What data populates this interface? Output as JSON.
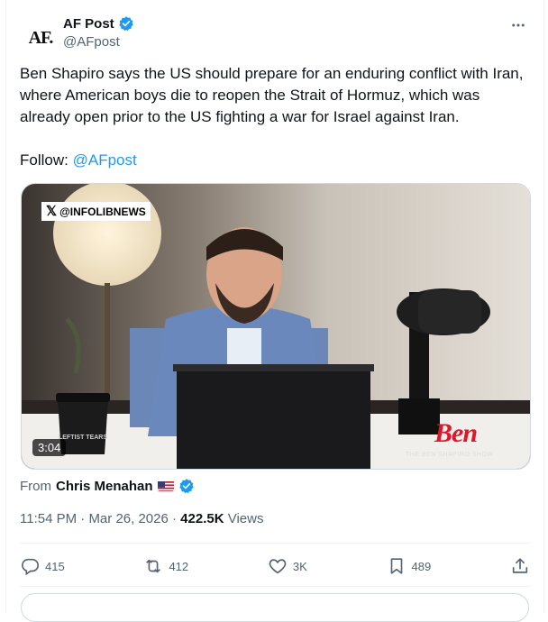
{
  "account": {
    "avatar_text": "AF.",
    "display_name": "AF Post",
    "handle": "@AFpost"
  },
  "tweet": {
    "text": "Ben Shapiro says the US should prepare for an enduring conflict with Iran, where American boys die to reopen the Strait of Hormuz, which was already open prior to the US fighting a war for Israel against Iran.",
    "follow_label": "Follow:",
    "follow_handle": "@AFpost"
  },
  "media": {
    "watermark": "@INFOLIBNEWS",
    "duration": "3:04",
    "show_logo_main": "Ben",
    "show_logo_sub": "THE BEN SHAPIRO SHOW",
    "mug_text": "LEFTIST TEARS"
  },
  "attribution": {
    "from_label": "From",
    "from_name": "Chris Menahan"
  },
  "meta": {
    "time": "11:54 PM",
    "separator": "·",
    "date": "Mar 26, 2026",
    "views_count": "422.5K",
    "views_label": "Views"
  },
  "actions": {
    "replies": "415",
    "reposts": "412",
    "likes": "3K",
    "bookmarks": "489"
  },
  "colors": {
    "accent": "#1d9bf0",
    "text": "#0f1419",
    "secondary": "#536471",
    "border": "#eff3f4"
  }
}
